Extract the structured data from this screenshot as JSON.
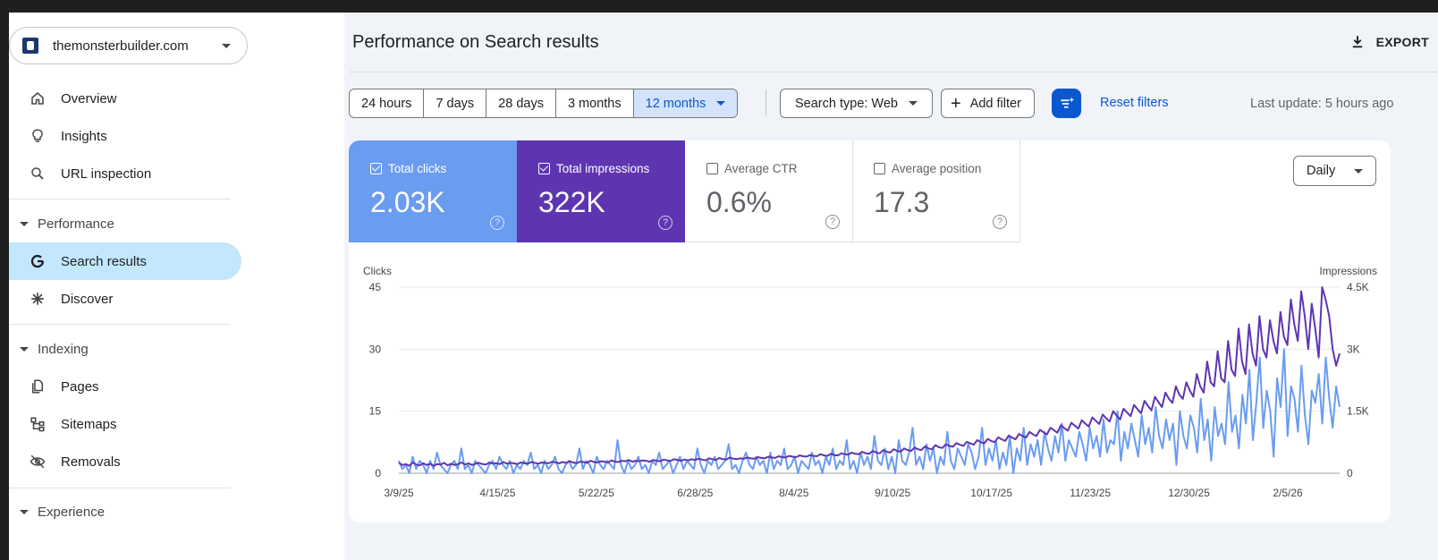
{
  "property": {
    "name": "themonsterbuilder.com"
  },
  "nav": {
    "overview": "Overview",
    "insights": "Insights",
    "url_inspection": "URL inspection",
    "performance_section": "Performance",
    "search_results": "Search results",
    "discover": "Discover",
    "indexing_section": "Indexing",
    "pages": "Pages",
    "sitemaps": "Sitemaps",
    "removals": "Removals",
    "experience_section": "Experience"
  },
  "header": {
    "title": "Performance on Search results",
    "export_label": "EXPORT"
  },
  "date_ranges": [
    "24 hours",
    "7 days",
    "28 days",
    "3 months",
    "12 months"
  ],
  "selected_range": "12 months",
  "filters": {
    "search_type": "Search type: Web",
    "add_filter": "Add filter",
    "reset": "Reset filters",
    "last_update": "Last update: 5 hours ago"
  },
  "metrics": {
    "clicks": {
      "label": "Total clicks",
      "value": "2.03K",
      "checked": true
    },
    "impressions": {
      "label": "Total impressions",
      "value": "322K",
      "checked": true
    },
    "ctr": {
      "label": "Average CTR",
      "value": "0.6%",
      "checked": false
    },
    "position": {
      "label": "Average position",
      "value": "17.3",
      "checked": false
    }
  },
  "granularity": "Daily",
  "colors": {
    "clicks": "#6a9cef",
    "impressions": "#5e35b1",
    "accent": "#0b57d0"
  },
  "chart_data": {
    "type": "line",
    "ylabel_left": "Clicks",
    "ylabel_right": "Impressions",
    "y_left_ticks": [
      "0",
      "15",
      "30",
      "45"
    ],
    "y_right_ticks": [
      "0",
      "1.5K",
      "3K",
      "4.5K"
    ],
    "ylim_left": [
      0,
      45
    ],
    "ylim_right": [
      0,
      4500
    ],
    "x_ticks": [
      "3/9/25",
      "4/15/25",
      "5/22/25",
      "6/28/25",
      "8/4/25",
      "9/10/25",
      "10/17/25",
      "11/23/25",
      "12/30/25",
      "2/5/26"
    ],
    "grid": true,
    "series": [
      {
        "name": "Clicks",
        "axis": "left",
        "color": "#6a9cef",
        "values": [
          3,
          1,
          2,
          0,
          4,
          1,
          3,
          2,
          0,
          3,
          1,
          5,
          2,
          1,
          0,
          2,
          3,
          1,
          6,
          1,
          2,
          0,
          3,
          2,
          1,
          0,
          2,
          3,
          1,
          4,
          2,
          1,
          3,
          0,
          2,
          1,
          3,
          2,
          5,
          1,
          2,
          0,
          3,
          1,
          2,
          4,
          1,
          0,
          2,
          3,
          1,
          2,
          6,
          1,
          3,
          2,
          0,
          4,
          2,
          1,
          3,
          2,
          1,
          8,
          2,
          0,
          3,
          1,
          2,
          4,
          1,
          2,
          0,
          3,
          2,
          5,
          1,
          2,
          3,
          0,
          2,
          4,
          1,
          3,
          2,
          1,
          6,
          2,
          0,
          3,
          2,
          4,
          1,
          2,
          3,
          7,
          1,
          2,
          0,
          3,
          5,
          2,
          1,
          4,
          2,
          3,
          0,
          5,
          1,
          3,
          2,
          6,
          1,
          2,
          4,
          0,
          3,
          2,
          1,
          5,
          2,
          3,
          0,
          4,
          2,
          6,
          1,
          3,
          2,
          8,
          1,
          3,
          0,
          5,
          2,
          4,
          1,
          9,
          3,
          2,
          6,
          1,
          4,
          0,
          8,
          3,
          2,
          5,
          11,
          2,
          4,
          1,
          7,
          3,
          6,
          0,
          4,
          2,
          10,
          3,
          1,
          6,
          4,
          2,
          7,
          5,
          1,
          4,
          11,
          2,
          6,
          3,
          8,
          1,
          5,
          2,
          9,
          0,
          6,
          3,
          11,
          2,
          7,
          4,
          8,
          2,
          10,
          6,
          3,
          9,
          5,
          12,
          3,
          8,
          6,
          4,
          10,
          7,
          3,
          11,
          6,
          9,
          4,
          13,
          5,
          8,
          7,
          15,
          3,
          10,
          6,
          12,
          8,
          4,
          14,
          7,
          11,
          5,
          16,
          9,
          6,
          13,
          8,
          12,
          2,
          15,
          9,
          6,
          14,
          11,
          5,
          18,
          8,
          13,
          3,
          16,
          9,
          12,
          7,
          22,
          10,
          14,
          6,
          19,
          12,
          25,
          8,
          17,
          28,
          11,
          20,
          15,
          4,
          23,
          16,
          30,
          9,
          21,
          18,
          10,
          26,
          14,
          7,
          20,
          17,
          24,
          12,
          28,
          18,
          11,
          21,
          16
        ],
        "notes": "approximate daily values read from chart"
      },
      {
        "name": "Impressions",
        "axis": "right",
        "color": "#5e35b1",
        "values": [
          250,
          200,
          220,
          180,
          260,
          210,
          190,
          240,
          200,
          230,
          180,
          220,
          210,
          250,
          190,
          230,
          200,
          220,
          260,
          210,
          240,
          200,
          230,
          250,
          220,
          210,
          260,
          230,
          240,
          220,
          270,
          230,
          250,
          240,
          220,
          260,
          240,
          230,
          270,
          250,
          230,
          260,
          250,
          240,
          280,
          260,
          240,
          270,
          250,
          290,
          260,
          240,
          280,
          270,
          250,
          300,
          270,
          260,
          290,
          280,
          260,
          310,
          280,
          270,
          300,
          290,
          320,
          280,
          300,
          290,
          310,
          300,
          280,
          320,
          300,
          290,
          330,
          310,
          300,
          340,
          320,
          300,
          330,
          310,
          340,
          320,
          350,
          330,
          310,
          360,
          340,
          320,
          370,
          340,
          330,
          380,
          350,
          340,
          360,
          350,
          380,
          360,
          350,
          390,
          370,
          360,
          400,
          380,
          370,
          410,
          390,
          380,
          420,
          400,
          390,
          430,
          410,
          400,
          440,
          420,
          410,
          460,
          430,
          420,
          470,
          440,
          430,
          480,
          460,
          450,
          500,
          470,
          460,
          520,
          480,
          470,
          540,
          500,
          480,
          560,
          520,
          500,
          580,
          540,
          520,
          600,
          560,
          540,
          620,
          580,
          560,
          650,
          600,
          580,
          680,
          630,
          610,
          700,
          660,
          640,
          730,
          690,
          660,
          760,
          720,
          690,
          800,
          750,
          720,
          830,
          780,
          750,
          870,
          820,
          780,
          910,
          860,
          820,
          950,
          900,
          860,
          1000,
          940,
          900,
          1050,
          990,
          940,
          1100,
          1040,
          980,
          1160,
          1090,
          1030,
          1220,
          1150,
          1080,
          1280,
          1200,
          1130,
          1350,
          1270,
          1190,
          1420,
          1330,
          1250,
          1500,
          1400,
          1300,
          1560,
          1470,
          1380,
          1650,
          1550,
          1450,
          1750,
          1630,
          1520,
          1850,
          1720,
          1600,
          1950,
          1800,
          1700,
          2100,
          1900,
          1800,
          2200,
          2000,
          1850,
          2400,
          2100,
          1950,
          2700,
          2200,
          2100,
          2950,
          2300,
          2200,
          3200,
          2500,
          2350,
          3500,
          2700,
          2400,
          3600,
          2900,
          2600,
          3800,
          3000,
          2800,
          3700,
          3200,
          2900,
          3900,
          3300,
          3100,
          4200,
          3600,
          3200,
          4400,
          3800,
          3000,
          4100,
          3500,
          2800,
          4500,
          4200,
          3800,
          3000,
          2600,
          2900
        ],
        "notes": "approximate daily values read from chart"
      }
    ]
  }
}
